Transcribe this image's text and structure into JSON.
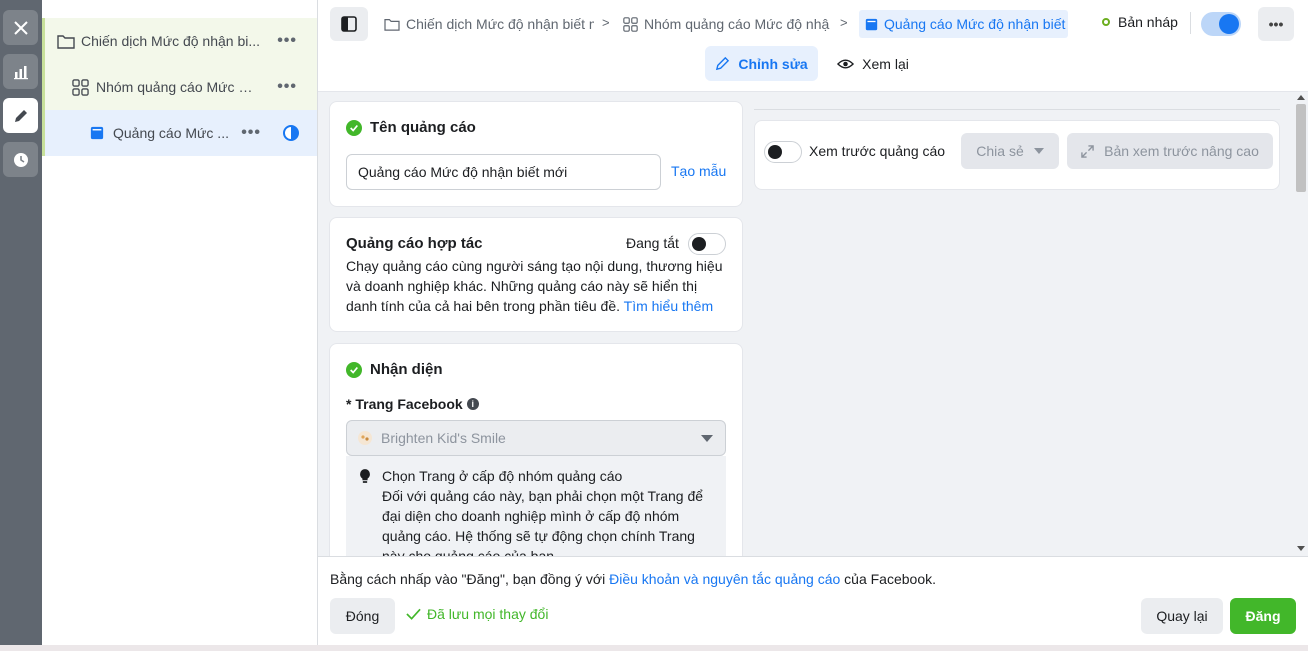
{
  "rail": {
    "items": [
      {
        "icon": "close-icon"
      },
      {
        "icon": "bar-chart-icon"
      },
      {
        "icon": "pencil-icon",
        "active": true
      },
      {
        "icon": "clock-icon"
      }
    ]
  },
  "tree": {
    "campaign": "Chiến dịch Mức độ nhận bi...",
    "adset": "Nhóm quảng cáo Mức đ...",
    "ad": "Quảng cáo Mức ...",
    "more": "•••"
  },
  "header": {
    "breadcrumbs": [
      "Chiến dịch Mức độ nhận biết m",
      "Nhóm quảng cáo Mức độ nhậ",
      "Quảng cáo Mức độ nhận biết"
    ],
    "status": "Bản nháp",
    "more": "•••",
    "mode_edit": "Chỉnh sửa",
    "mode_review": "Xem lại"
  },
  "ad_name": {
    "title": "Tên quảng cáo",
    "value": "Quảng cáo Mức độ nhận biết mới",
    "template_link": "Tạo mẫu"
  },
  "partnership": {
    "title": "Quảng cáo hợp tác",
    "state": "Đang tắt",
    "description": "Chạy quảng cáo cùng người sáng tạo nội dung, thương hiệu và doanh nghiệp khác. Những quảng cáo này sẽ hiển thị danh tính của cả hai bên trong phần tiêu đề. ",
    "learn_more": "Tìm hiểu thêm"
  },
  "identity": {
    "title": "Nhận diện",
    "page_label": "* Trang Facebook",
    "page_value": "Brighten Kid's Smile",
    "hint_title": "Chọn Trang ở cấp độ nhóm quảng cáo",
    "hint_body": "Đối với quảng cáo này, bạn phải chọn một Trang để đại diện cho doanh nghiệp mình ở cấp độ nhóm quảng cáo. Hệ thống sẽ tự động chọn chính Trang này cho quảng cáo của bạn."
  },
  "preview": {
    "toggle_label": "Xem trước quảng cáo",
    "share": "Chia sẻ",
    "advanced": "Bản xem trước nâng cao"
  },
  "footer": {
    "terms_prefix": "Bằng cách nhấp vào \"Đăng\", bạn đồng ý với ",
    "terms_link": "Điều khoản và nguyên tắc quảng cáo",
    "terms_suffix": " của Facebook.",
    "close": "Đóng",
    "saved": "Đã lưu mọi thay đổi",
    "back": "Quay lại",
    "publish": "Đăng"
  },
  "colors": {
    "accent": "#1877f2",
    "success": "#42b72a",
    "rail": "#606770"
  }
}
